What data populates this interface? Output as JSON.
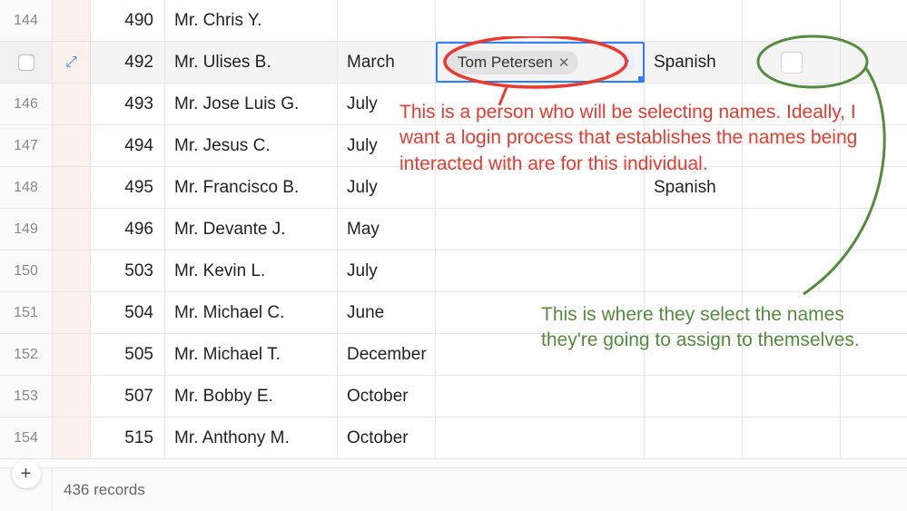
{
  "rows": [
    {
      "rownum": "144",
      "id": "490",
      "name": "Mr. Chris Y.",
      "month": "",
      "lang": "",
      "selected": false
    },
    {
      "rownum": "",
      "id": "492",
      "name": "Mr. Ulises B.",
      "month": "March",
      "lang": "Spanish",
      "selected": true,
      "person_tag": "Tom Petersen"
    },
    {
      "rownum": "146",
      "id": "493",
      "name": "Mr. Jose Luis G.",
      "month": "July",
      "lang": "",
      "selected": false
    },
    {
      "rownum": "147",
      "id": "494",
      "name": "Mr. Jesus C.",
      "month": "July",
      "lang": "",
      "selected": false
    },
    {
      "rownum": "148",
      "id": "495",
      "name": "Mr. Francisco B.",
      "month": "July",
      "lang": "Spanish",
      "selected": false
    },
    {
      "rownum": "149",
      "id": "496",
      "name": "Mr. Devante J.",
      "month": "May",
      "lang": "",
      "selected": false
    },
    {
      "rownum": "150",
      "id": "503",
      "name": "Mr. Kevin L.",
      "month": "July",
      "lang": "",
      "selected": false
    },
    {
      "rownum": "151",
      "id": "504",
      "name": "Mr. Michael C.",
      "month": "June",
      "lang": "",
      "selected": false
    },
    {
      "rownum": "152",
      "id": "505",
      "name": "Mr. Michael T.",
      "month": "December",
      "lang": "",
      "selected": false
    },
    {
      "rownum": "153",
      "id": "507",
      "name": "Mr. Bobby E.",
      "month": "October",
      "lang": "",
      "selected": false
    },
    {
      "rownum": "154",
      "id": "515",
      "name": "Mr. Anthony M.",
      "month": "October",
      "lang": "",
      "selected": false
    }
  ],
  "footer": {
    "record_count": "436 records",
    "add_label": "+"
  },
  "annotations": {
    "red_text": "This is a person who will be selecting names. Ideally, I want a login process that establishes the names being interacted with are for this individual.",
    "green_text": "This is where they select the names they're going to assign to themselves."
  }
}
